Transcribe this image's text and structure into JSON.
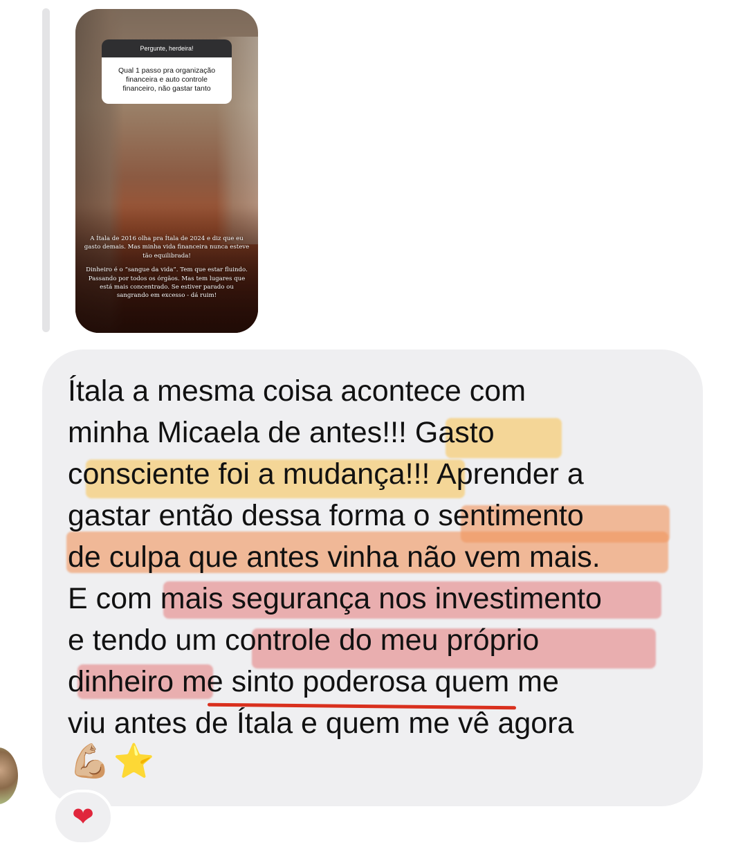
{
  "story_reply": {
    "question_header": "Pergunte, herdeira!",
    "question_text_lines": [
      "Qual 1 passo pra organização",
      "financeira e auto controle",
      "financeiro, não gastar tanto"
    ],
    "caption_paragraphs": [
      "A Ítala de 2016 olha pra Ítala de 2024 e diz que eu gasto demais. Mas minha vida financeira nunca esteve tão equilibrada!",
      "Dinheiro é o “sangue da vida”. Tem que estar fluindo. Passando por todos os órgãos. Mas tem lugares que está mais concentrado. Se estiver parado ou sangrando em excesso - dá ruim!"
    ]
  },
  "message": {
    "lines": [
      "Ítala a mesma coisa acontece com",
      "minha Micaela de antes!!! Gasto",
      "consciente foi a mudança!!! Aprender a",
      "gastar então dessa forma o sentimento",
      "de culpa que antes vinha não vem mais.",
      "E com mais segurança nos investimento",
      "e tendo um controle do meu próprio",
      "dinheiro me sinto poderosa quem me",
      "viu antes de Ítala e quem me vê agora"
    ],
    "emojis": "💪🏼⭐",
    "highlight_colors": {
      "yellow": "#f5ce78",
      "orange": "#f0965f",
      "red": "#e47878",
      "underline": "#d9301e"
    }
  },
  "reaction": {
    "icon": "heart-icon",
    "glyph": "❤"
  },
  "colors": {
    "bubble_bg": "#efeff1",
    "reply_bar": "#e4e4e6",
    "text": "#111111"
  }
}
